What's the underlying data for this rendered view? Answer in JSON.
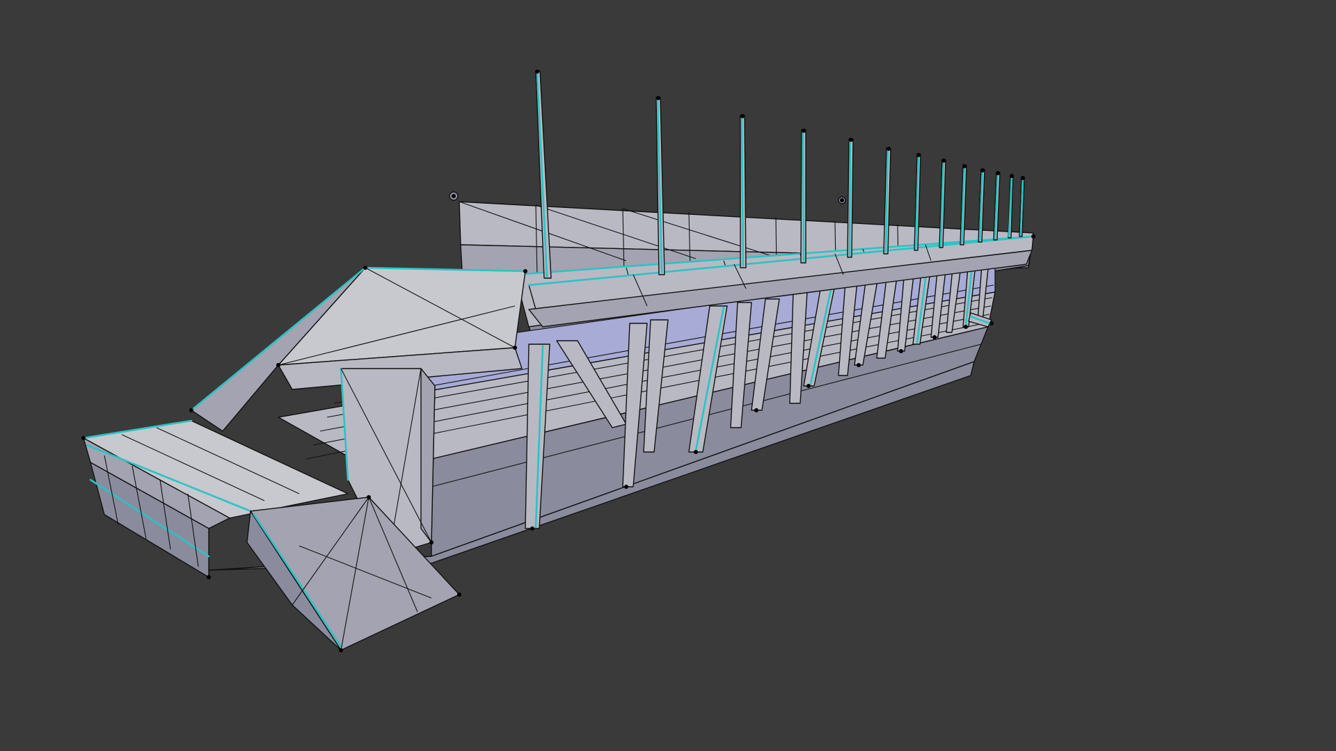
{
  "viewport": {
    "background_color": "#3a3a3a",
    "display_mode": "wireframe-on-shaded",
    "object_colors": {
      "face": "#b9b9c4",
      "selected_edge": "#29c4c4",
      "edge": "#111111"
    },
    "object": "grandstand"
  }
}
